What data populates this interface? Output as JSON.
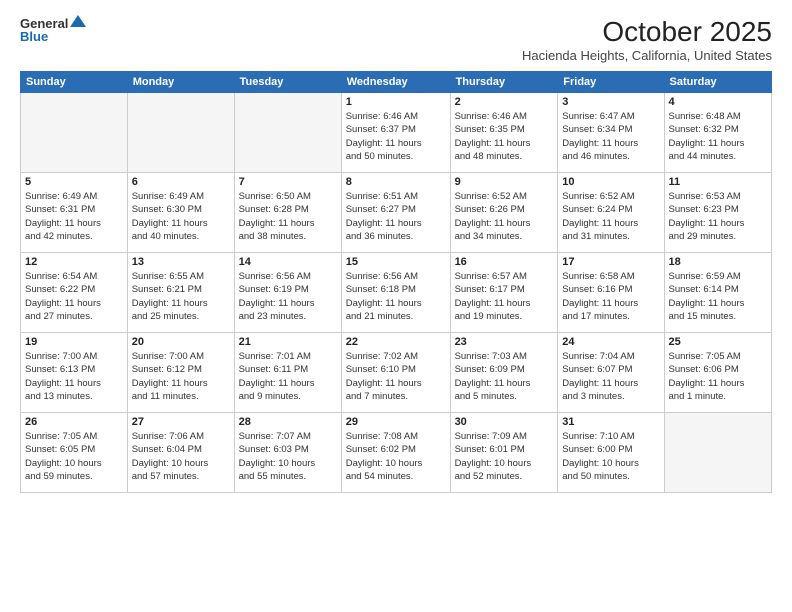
{
  "logo": {
    "general": "General",
    "blue": "Blue"
  },
  "header": {
    "month": "October 2025",
    "location": "Hacienda Heights, California, United States"
  },
  "weekdays": [
    "Sunday",
    "Monday",
    "Tuesday",
    "Wednesday",
    "Thursday",
    "Friday",
    "Saturday"
  ],
  "weeks": [
    [
      {
        "day": "",
        "info": ""
      },
      {
        "day": "",
        "info": ""
      },
      {
        "day": "",
        "info": ""
      },
      {
        "day": "1",
        "info": "Sunrise: 6:46 AM\nSunset: 6:37 PM\nDaylight: 11 hours\nand 50 minutes."
      },
      {
        "day": "2",
        "info": "Sunrise: 6:46 AM\nSunset: 6:35 PM\nDaylight: 11 hours\nand 48 minutes."
      },
      {
        "day": "3",
        "info": "Sunrise: 6:47 AM\nSunset: 6:34 PM\nDaylight: 11 hours\nand 46 minutes."
      },
      {
        "day": "4",
        "info": "Sunrise: 6:48 AM\nSunset: 6:32 PM\nDaylight: 11 hours\nand 44 minutes."
      }
    ],
    [
      {
        "day": "5",
        "info": "Sunrise: 6:49 AM\nSunset: 6:31 PM\nDaylight: 11 hours\nand 42 minutes."
      },
      {
        "day": "6",
        "info": "Sunrise: 6:49 AM\nSunset: 6:30 PM\nDaylight: 11 hours\nand 40 minutes."
      },
      {
        "day": "7",
        "info": "Sunrise: 6:50 AM\nSunset: 6:28 PM\nDaylight: 11 hours\nand 38 minutes."
      },
      {
        "day": "8",
        "info": "Sunrise: 6:51 AM\nSunset: 6:27 PM\nDaylight: 11 hours\nand 36 minutes."
      },
      {
        "day": "9",
        "info": "Sunrise: 6:52 AM\nSunset: 6:26 PM\nDaylight: 11 hours\nand 34 minutes."
      },
      {
        "day": "10",
        "info": "Sunrise: 6:52 AM\nSunset: 6:24 PM\nDaylight: 11 hours\nand 31 minutes."
      },
      {
        "day": "11",
        "info": "Sunrise: 6:53 AM\nSunset: 6:23 PM\nDaylight: 11 hours\nand 29 minutes."
      }
    ],
    [
      {
        "day": "12",
        "info": "Sunrise: 6:54 AM\nSunset: 6:22 PM\nDaylight: 11 hours\nand 27 minutes."
      },
      {
        "day": "13",
        "info": "Sunrise: 6:55 AM\nSunset: 6:21 PM\nDaylight: 11 hours\nand 25 minutes."
      },
      {
        "day": "14",
        "info": "Sunrise: 6:56 AM\nSunset: 6:19 PM\nDaylight: 11 hours\nand 23 minutes."
      },
      {
        "day": "15",
        "info": "Sunrise: 6:56 AM\nSunset: 6:18 PM\nDaylight: 11 hours\nand 21 minutes."
      },
      {
        "day": "16",
        "info": "Sunrise: 6:57 AM\nSunset: 6:17 PM\nDaylight: 11 hours\nand 19 minutes."
      },
      {
        "day": "17",
        "info": "Sunrise: 6:58 AM\nSunset: 6:16 PM\nDaylight: 11 hours\nand 17 minutes."
      },
      {
        "day": "18",
        "info": "Sunrise: 6:59 AM\nSunset: 6:14 PM\nDaylight: 11 hours\nand 15 minutes."
      }
    ],
    [
      {
        "day": "19",
        "info": "Sunrise: 7:00 AM\nSunset: 6:13 PM\nDaylight: 11 hours\nand 13 minutes."
      },
      {
        "day": "20",
        "info": "Sunrise: 7:00 AM\nSunset: 6:12 PM\nDaylight: 11 hours\nand 11 minutes."
      },
      {
        "day": "21",
        "info": "Sunrise: 7:01 AM\nSunset: 6:11 PM\nDaylight: 11 hours\nand 9 minutes."
      },
      {
        "day": "22",
        "info": "Sunrise: 7:02 AM\nSunset: 6:10 PM\nDaylight: 11 hours\nand 7 minutes."
      },
      {
        "day": "23",
        "info": "Sunrise: 7:03 AM\nSunset: 6:09 PM\nDaylight: 11 hours\nand 5 minutes."
      },
      {
        "day": "24",
        "info": "Sunrise: 7:04 AM\nSunset: 6:07 PM\nDaylight: 11 hours\nand 3 minutes."
      },
      {
        "day": "25",
        "info": "Sunrise: 7:05 AM\nSunset: 6:06 PM\nDaylight: 11 hours\nand 1 minute."
      }
    ],
    [
      {
        "day": "26",
        "info": "Sunrise: 7:05 AM\nSunset: 6:05 PM\nDaylight: 10 hours\nand 59 minutes."
      },
      {
        "day": "27",
        "info": "Sunrise: 7:06 AM\nSunset: 6:04 PM\nDaylight: 10 hours\nand 57 minutes."
      },
      {
        "day": "28",
        "info": "Sunrise: 7:07 AM\nSunset: 6:03 PM\nDaylight: 10 hours\nand 55 minutes."
      },
      {
        "day": "29",
        "info": "Sunrise: 7:08 AM\nSunset: 6:02 PM\nDaylight: 10 hours\nand 54 minutes."
      },
      {
        "day": "30",
        "info": "Sunrise: 7:09 AM\nSunset: 6:01 PM\nDaylight: 10 hours\nand 52 minutes."
      },
      {
        "day": "31",
        "info": "Sunrise: 7:10 AM\nSunset: 6:00 PM\nDaylight: 10 hours\nand 50 minutes."
      },
      {
        "day": "",
        "info": ""
      }
    ]
  ]
}
